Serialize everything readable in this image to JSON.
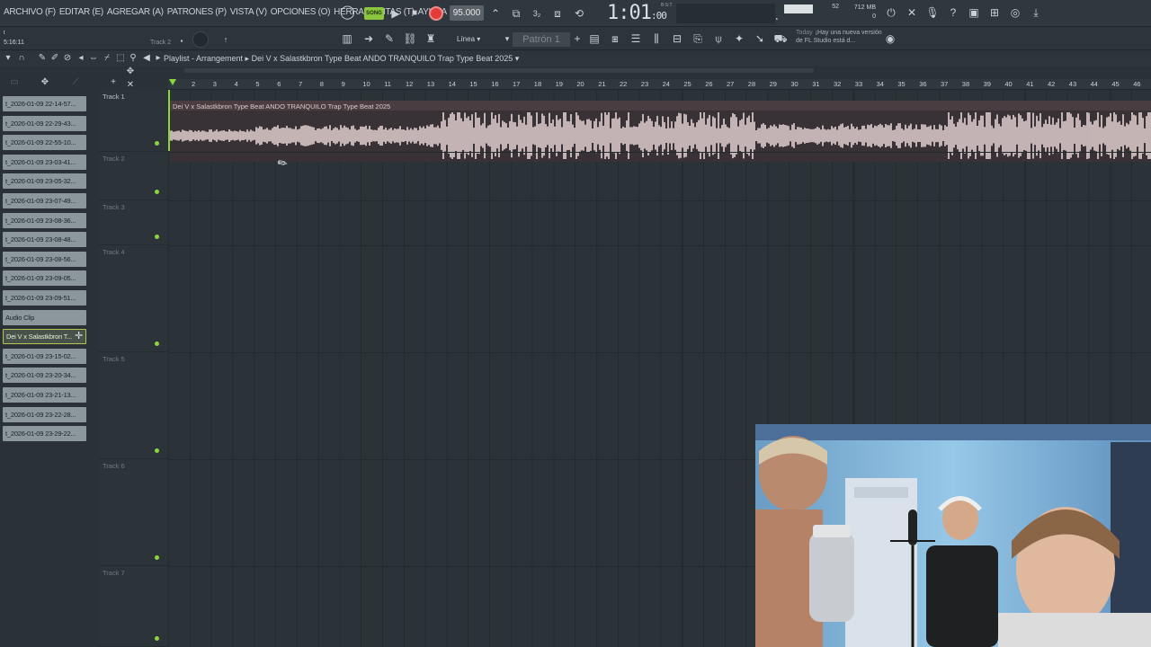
{
  "menu": [
    "ARCHIVO (F)",
    "EDITAR (E)",
    "AGREGAR (A)",
    "PATRONES (P)",
    "VISTA (V)",
    "OPCIONES (O)",
    "HERRAMIENTAS (T)",
    "AYUDA"
  ],
  "transport": {
    "song_label": "SONG",
    "tempo": "95.000",
    "time": "1:01",
    "time_small": ":00",
    "time_sub": "B:S:T"
  },
  "monitor": {
    "cpu": "52",
    "mem_mb": "712 MB",
    "mem_val": "0"
  },
  "toolbar2": {
    "time": "5:16:11",
    "t_label": "t",
    "track_hint": "Track 2",
    "snap": "Línea",
    "pattern": "Patrón 1",
    "news_today": "Today",
    "news_text": "¡Hay una nueva versión de FL Studio está d..."
  },
  "playlist": {
    "title": "Playlist - Arrangement",
    "clip_title": "Dei V x Salastkbron Type Beat  ANDO TRANQUILO  Trap Type Beat 2025"
  },
  "browser_clips": [
    "t_2026-01-09 22-14-57...",
    "t_2026-01-09 22-29-43...",
    "t_2026-01-09 22-55-10...",
    "t_2026-01-09 23-03-41...",
    "t_2026-01-09 23-05-32...",
    "t_2026-01-09 23-07-49...",
    "t_2026-01-09 23-08-36...",
    "t_2026-01-09 23-08-48...",
    "t_2026-01-09 23-08-56...",
    "t_2026-01-09 23-09-05...",
    "t_2026-01-09 23-09-51...",
    "Audio Clip",
    "Dei V x Salastkbron T...",
    "t_2026-01-09 23-15-02...",
    "t_2026-01-09 23-20-34...",
    "t_2026-01-09 23-21-13...",
    "t_2026-01-09 23-22-28...",
    "t_2026-01-09 23-29-22..."
  ],
  "selected_clip_index": 12,
  "tracks": [
    "Track 1",
    "Track 2",
    "Track 3",
    "Track 4",
    "Track 5",
    "Track 6",
    "Track 7"
  ],
  "ruler": [
    "2",
    "3",
    "4",
    "5",
    "6",
    "7",
    "8",
    "9",
    "10",
    "11",
    "12",
    "13",
    "14",
    "15",
    "16",
    "17",
    "18",
    "19",
    "20",
    "21",
    "22",
    "23",
    "24",
    "25",
    "26",
    "27",
    "28",
    "29",
    "30",
    "31",
    "32",
    "33",
    "34",
    "35",
    "36",
    "37",
    "38",
    "39",
    "40",
    "41",
    "42",
    "43",
    "44",
    "45",
    "46"
  ],
  "colors": {
    "accent": "#8bd63e",
    "record": "#e53a3a",
    "clip": "#8b969d",
    "waveform": "#e7d4d4"
  }
}
